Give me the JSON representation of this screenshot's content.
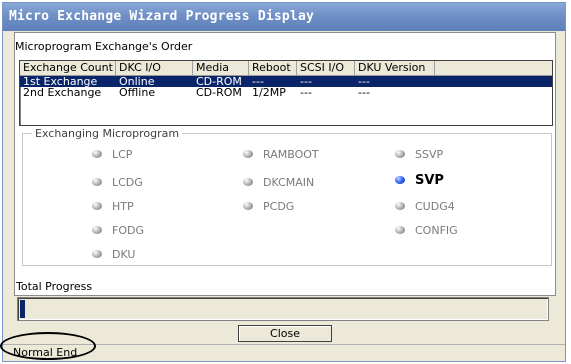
{
  "window": {
    "title": "Micro Exchange Wizard Progress Display"
  },
  "order": {
    "label": "Microprogram Exchange's Order",
    "columns": [
      "Exchange Count",
      "DKC I/O",
      "Media",
      "Reboot",
      "SCSI I/O",
      "DKU Version"
    ],
    "rows": [
      [
        "1st Exchange",
        "Online",
        "CD-ROM",
        "---",
        "---",
        "---"
      ],
      [
        "2nd Exchange",
        "Offline",
        "CD-ROM",
        "1/2MP",
        "---",
        "---"
      ]
    ],
    "selected_row": 0
  },
  "exchanging": {
    "label": "Exchanging Microprogram",
    "items": {
      "lcp": "LCP",
      "ramboot": "RAMBOOT",
      "ssvp": "SSVP",
      "lcdg": "LCDG",
      "dkcmain": "DKCMAIN",
      "svp": "SVP",
      "htp": "HTP",
      "pcdg": "PCDG",
      "cudg4": "CUDG4",
      "fodg": "FODG",
      "config": "CONFIG",
      "dku": "DKU"
    },
    "active": "SVP",
    "active_color": "#1f4fff"
  },
  "progress": {
    "label": "Total Progress",
    "value": 0.01
  },
  "buttons": {
    "close": "Close"
  },
  "status": {
    "text": "Normal End"
  }
}
